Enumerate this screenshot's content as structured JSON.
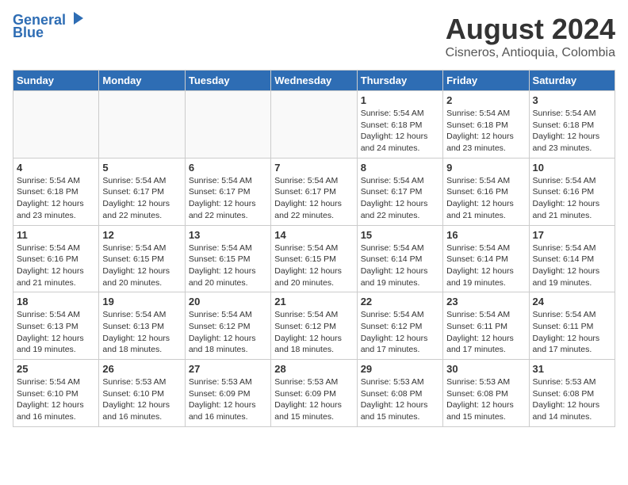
{
  "logo": {
    "line1": "General",
    "line2": "Blue"
  },
  "title": "August 2024",
  "subtitle": "Cisneros, Antioquia, Colombia",
  "weekdays": [
    "Sunday",
    "Monday",
    "Tuesday",
    "Wednesday",
    "Thursday",
    "Friday",
    "Saturday"
  ],
  "weeks": [
    [
      {
        "day": "",
        "info": ""
      },
      {
        "day": "",
        "info": ""
      },
      {
        "day": "",
        "info": ""
      },
      {
        "day": "",
        "info": ""
      },
      {
        "day": "1",
        "info": "Sunrise: 5:54 AM\nSunset: 6:18 PM\nDaylight: 12 hours\nand 24 minutes."
      },
      {
        "day": "2",
        "info": "Sunrise: 5:54 AM\nSunset: 6:18 PM\nDaylight: 12 hours\nand 23 minutes."
      },
      {
        "day": "3",
        "info": "Sunrise: 5:54 AM\nSunset: 6:18 PM\nDaylight: 12 hours\nand 23 minutes."
      }
    ],
    [
      {
        "day": "4",
        "info": "Sunrise: 5:54 AM\nSunset: 6:18 PM\nDaylight: 12 hours\nand 23 minutes."
      },
      {
        "day": "5",
        "info": "Sunrise: 5:54 AM\nSunset: 6:17 PM\nDaylight: 12 hours\nand 22 minutes."
      },
      {
        "day": "6",
        "info": "Sunrise: 5:54 AM\nSunset: 6:17 PM\nDaylight: 12 hours\nand 22 minutes."
      },
      {
        "day": "7",
        "info": "Sunrise: 5:54 AM\nSunset: 6:17 PM\nDaylight: 12 hours\nand 22 minutes."
      },
      {
        "day": "8",
        "info": "Sunrise: 5:54 AM\nSunset: 6:17 PM\nDaylight: 12 hours\nand 22 minutes."
      },
      {
        "day": "9",
        "info": "Sunrise: 5:54 AM\nSunset: 6:16 PM\nDaylight: 12 hours\nand 21 minutes."
      },
      {
        "day": "10",
        "info": "Sunrise: 5:54 AM\nSunset: 6:16 PM\nDaylight: 12 hours\nand 21 minutes."
      }
    ],
    [
      {
        "day": "11",
        "info": "Sunrise: 5:54 AM\nSunset: 6:16 PM\nDaylight: 12 hours\nand 21 minutes."
      },
      {
        "day": "12",
        "info": "Sunrise: 5:54 AM\nSunset: 6:15 PM\nDaylight: 12 hours\nand 20 minutes."
      },
      {
        "day": "13",
        "info": "Sunrise: 5:54 AM\nSunset: 6:15 PM\nDaylight: 12 hours\nand 20 minutes."
      },
      {
        "day": "14",
        "info": "Sunrise: 5:54 AM\nSunset: 6:15 PM\nDaylight: 12 hours\nand 20 minutes."
      },
      {
        "day": "15",
        "info": "Sunrise: 5:54 AM\nSunset: 6:14 PM\nDaylight: 12 hours\nand 19 minutes."
      },
      {
        "day": "16",
        "info": "Sunrise: 5:54 AM\nSunset: 6:14 PM\nDaylight: 12 hours\nand 19 minutes."
      },
      {
        "day": "17",
        "info": "Sunrise: 5:54 AM\nSunset: 6:14 PM\nDaylight: 12 hours\nand 19 minutes."
      }
    ],
    [
      {
        "day": "18",
        "info": "Sunrise: 5:54 AM\nSunset: 6:13 PM\nDaylight: 12 hours\nand 19 minutes."
      },
      {
        "day": "19",
        "info": "Sunrise: 5:54 AM\nSunset: 6:13 PM\nDaylight: 12 hours\nand 18 minutes."
      },
      {
        "day": "20",
        "info": "Sunrise: 5:54 AM\nSunset: 6:12 PM\nDaylight: 12 hours\nand 18 minutes."
      },
      {
        "day": "21",
        "info": "Sunrise: 5:54 AM\nSunset: 6:12 PM\nDaylight: 12 hours\nand 18 minutes."
      },
      {
        "day": "22",
        "info": "Sunrise: 5:54 AM\nSunset: 6:12 PM\nDaylight: 12 hours\nand 17 minutes."
      },
      {
        "day": "23",
        "info": "Sunrise: 5:54 AM\nSunset: 6:11 PM\nDaylight: 12 hours\nand 17 minutes."
      },
      {
        "day": "24",
        "info": "Sunrise: 5:54 AM\nSunset: 6:11 PM\nDaylight: 12 hours\nand 17 minutes."
      }
    ],
    [
      {
        "day": "25",
        "info": "Sunrise: 5:54 AM\nSunset: 6:10 PM\nDaylight: 12 hours\nand 16 minutes."
      },
      {
        "day": "26",
        "info": "Sunrise: 5:53 AM\nSunset: 6:10 PM\nDaylight: 12 hours\nand 16 minutes."
      },
      {
        "day": "27",
        "info": "Sunrise: 5:53 AM\nSunset: 6:09 PM\nDaylight: 12 hours\nand 16 minutes."
      },
      {
        "day": "28",
        "info": "Sunrise: 5:53 AM\nSunset: 6:09 PM\nDaylight: 12 hours\nand 15 minutes."
      },
      {
        "day": "29",
        "info": "Sunrise: 5:53 AM\nSunset: 6:08 PM\nDaylight: 12 hours\nand 15 minutes."
      },
      {
        "day": "30",
        "info": "Sunrise: 5:53 AM\nSunset: 6:08 PM\nDaylight: 12 hours\nand 15 minutes."
      },
      {
        "day": "31",
        "info": "Sunrise: 5:53 AM\nSunset: 6:08 PM\nDaylight: 12 hours\nand 14 minutes."
      }
    ]
  ]
}
